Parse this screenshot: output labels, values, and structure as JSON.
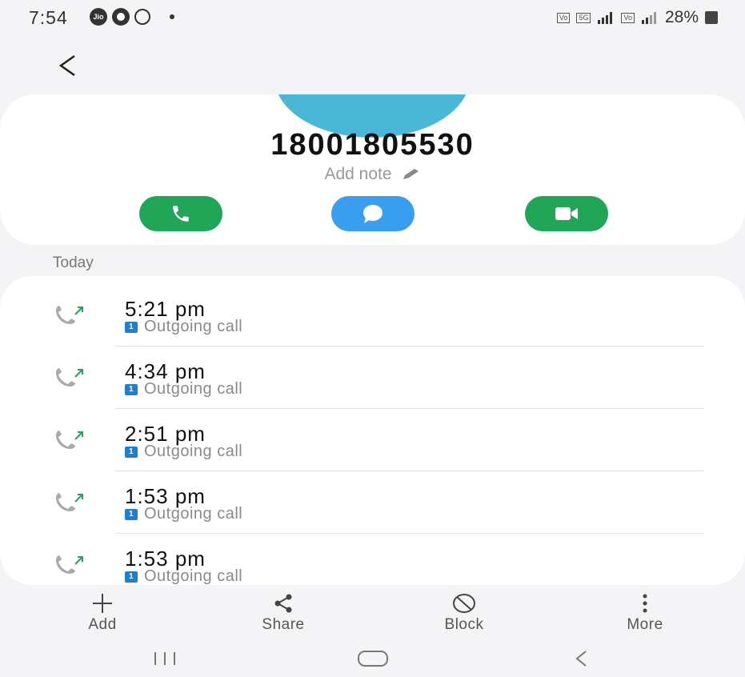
{
  "status_bar": {
    "time": "7:54",
    "battery_percent": "28%",
    "jio_label": "Jio"
  },
  "contact": {
    "phone_number": "18001805530",
    "add_note": "Add note"
  },
  "actions": {
    "call_color": "#21a556",
    "message_color": "#3a9ef0",
    "video_color": "#21a556"
  },
  "section": {
    "title": "Today"
  },
  "calls": [
    {
      "time": "5:21 pm",
      "type": "Outgoing call",
      "sim": "1"
    },
    {
      "time": "4:34 pm",
      "type": "Outgoing call",
      "sim": "1"
    },
    {
      "time": "2:51 pm",
      "type": "Outgoing call",
      "sim": "1"
    },
    {
      "time": "1:53 pm",
      "type": "Outgoing call",
      "sim": "1"
    },
    {
      "time": "1:53 pm",
      "type": "Outgoing call",
      "sim": "1"
    }
  ],
  "bottom_actions": {
    "add": "Add",
    "share": "Share",
    "block": "Block",
    "more": "More"
  }
}
